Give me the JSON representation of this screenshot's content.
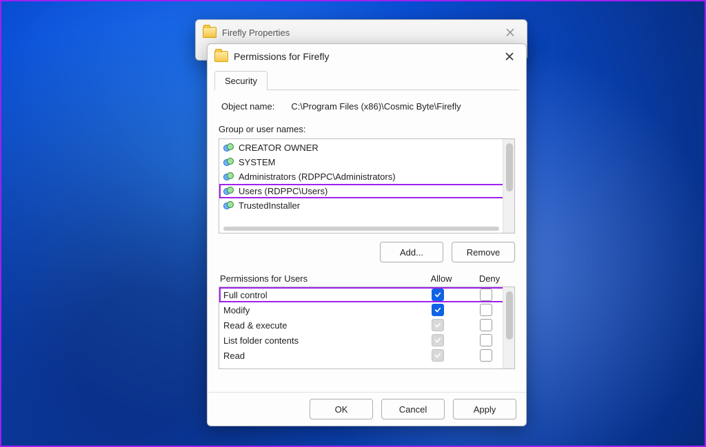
{
  "props_window": {
    "title": "Firefly Properties"
  },
  "perm_window": {
    "title": "Permissions for Firefly",
    "tab": "Security",
    "object_label": "Object name:",
    "object_path": "C:\\Program Files (x86)\\Cosmic Byte\\Firefly",
    "group_label": "Group or user names:",
    "groups": [
      {
        "name": "CREATOR OWNER"
      },
      {
        "name": "SYSTEM"
      },
      {
        "name": "Administrators (RDPPC\\Administrators)"
      },
      {
        "name": "Users (RDPPC\\Users)",
        "selected": true
      },
      {
        "name": "TrustedInstaller"
      }
    ],
    "add_btn": "Add...",
    "remove_btn": "Remove",
    "perm_for_label": "Permissions for Users",
    "col_allow": "Allow",
    "col_deny": "Deny",
    "perms": [
      {
        "name": "Full control",
        "allow": "checked",
        "deny": "unchecked",
        "hl": true
      },
      {
        "name": "Modify",
        "allow": "checked",
        "deny": "unchecked"
      },
      {
        "name": "Read & execute",
        "allow": "inherited",
        "deny": "unchecked"
      },
      {
        "name": "List folder contents",
        "allow": "inherited",
        "deny": "unchecked"
      },
      {
        "name": "Read",
        "allow": "inherited",
        "deny": "unchecked"
      }
    ],
    "ok": "OK",
    "cancel": "Cancel",
    "apply": "Apply"
  }
}
